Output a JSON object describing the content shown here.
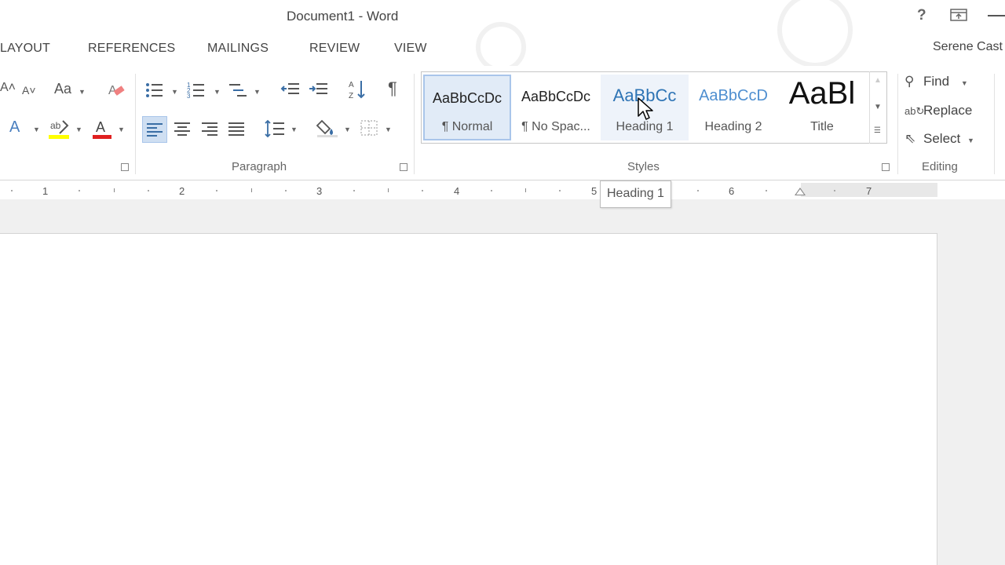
{
  "window": {
    "title": "Document1 - Word",
    "help_glyph": "?"
  },
  "tabs": [
    "LAYOUT",
    "REFERENCES",
    "MAILINGS",
    "REVIEW",
    "VIEW"
  ],
  "user": {
    "name": "Serene Cast"
  },
  "ribbon": {
    "font_group": {
      "change_case_label": "Aa"
    },
    "groups": {
      "paragraph_label": "Paragraph",
      "styles_label": "Styles",
      "editing_label": "Editing"
    },
    "styles": [
      {
        "preview": "AaBbCcDc",
        "name": "¶ Normal",
        "preview_color": "#222222"
      },
      {
        "preview": "AaBbCcDc",
        "name": "¶ No Spac...",
        "preview_color": "#222222"
      },
      {
        "preview": "AaBbCc",
        "name": "Heading 1",
        "preview_color": "#2e74b5"
      },
      {
        "preview": "AaBbCcD",
        "name": "Heading 2",
        "preview_color": "#4f8fd0"
      },
      {
        "preview": "AaBl",
        "name": "Title",
        "preview_color": "#111111"
      }
    ],
    "editing": {
      "find_label": "Find",
      "replace_label": "Replace",
      "select_label": "Select"
    }
  },
  "ruler": {
    "numbers": [
      "1",
      "2",
      "3",
      "4",
      "5",
      "6",
      "7"
    ]
  },
  "tooltip": {
    "text": "Heading 1"
  },
  "colors": {
    "accent_blue": "#2e74b5",
    "highlight_yellow": "#ffff00",
    "font_color_red": "#e02020"
  }
}
